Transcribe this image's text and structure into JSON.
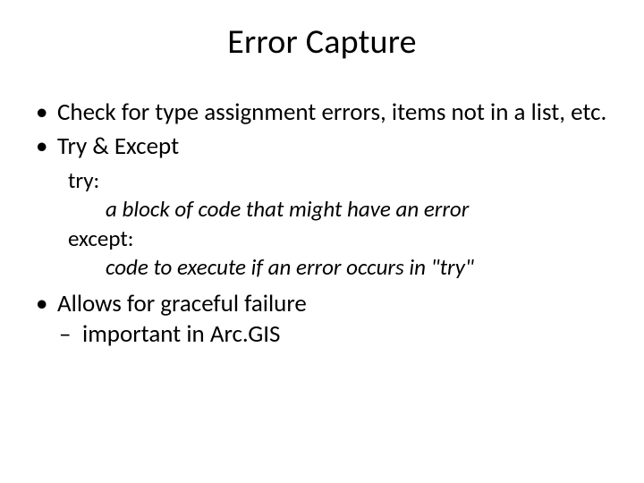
{
  "title": "Error Capture",
  "bullets": {
    "b1": "Check for type assignment errors, items not in a list, etc.",
    "b2": "Try & Except",
    "b3": "Allows for graceful failure"
  },
  "code": {
    "l1": "try:",
    "l2": "a block of code that might have an error",
    "l3": "except:",
    "l4": "code to execute if an error occurs in \"try\""
  },
  "sub": {
    "s1": "important in Arc.GIS"
  }
}
